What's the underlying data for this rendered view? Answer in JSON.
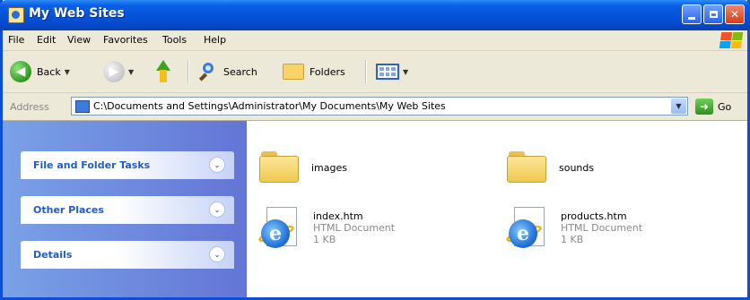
{
  "window": {
    "title": "My Web Sites"
  },
  "menu": [
    "File",
    "Edit",
    "View",
    "Favorites",
    "Tools",
    "Help"
  ],
  "toolbar": {
    "back_label": "Back",
    "search_label": "Search",
    "folders_label": "Folders"
  },
  "address": {
    "label": "Address",
    "path": "C:\\Documents and Settings\\Administrator\\My Documents\\My Web Sites",
    "go_label": "Go"
  },
  "tasks": [
    {
      "label": "File and Folder Tasks"
    },
    {
      "label": "Other Places"
    },
    {
      "label": "Details"
    }
  ],
  "items": [
    {
      "name": "images",
      "type": "folder"
    },
    {
      "name": "sounds",
      "type": "folder"
    },
    {
      "name": "index.htm",
      "type_label": "HTML Document",
      "size": "1 KB"
    },
    {
      "name": "products.htm",
      "type_label": "HTML Document",
      "size": "1 KB"
    }
  ],
  "colors": {
    "title_bar": "#0452d5",
    "left_pane": "#6f8fe0",
    "task_link": "#215dc6"
  }
}
